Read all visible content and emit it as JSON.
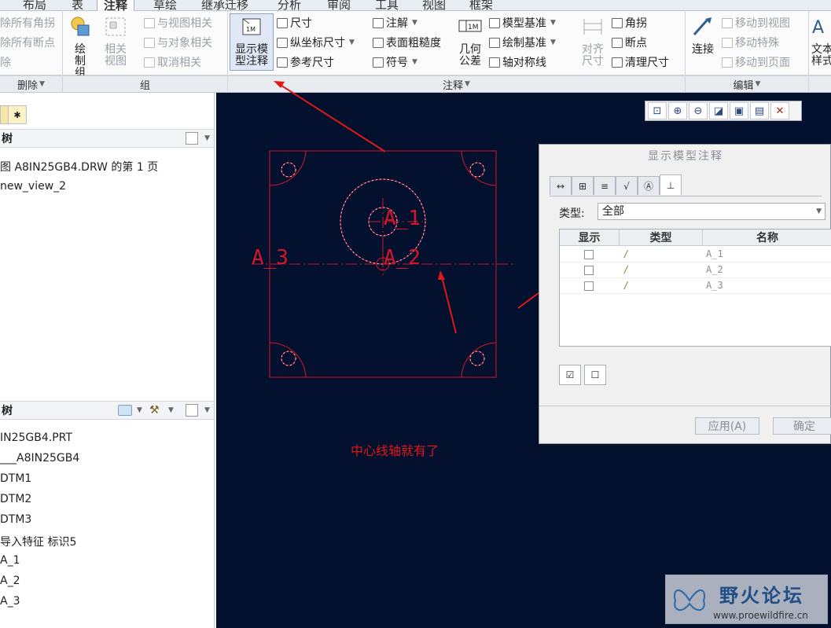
{
  "ribbon_tabs": [
    "布局",
    "表",
    "注释",
    "草绘",
    "继承迁移",
    "分析",
    "审阅",
    "工具",
    "视图",
    "框架"
  ],
  "active_tab": "注释",
  "group_delete": {
    "items": [
      "除所有角拐",
      "除所有断点",
      "除"
    ],
    "label": "删除"
  },
  "group_group": {
    "draw_group": "绘制组",
    "related_view": "相关视图",
    "items": [
      "与视图相关",
      "与对象相关",
      "取消相关"
    ],
    "label": "组"
  },
  "group_annotation": {
    "show_model_annotation": "显示模型注释",
    "col1": [
      "尺寸",
      "纵坐标尺寸",
      "参考尺寸"
    ],
    "col2": [
      "注解",
      "表面粗糙度",
      "符号"
    ],
    "geo_tolerance": "几何公差",
    "col3": [
      "模型基准",
      "绘制基准",
      "轴对称线"
    ],
    "align_dimension": "对齐尺寸",
    "col4": [
      "角拐",
      "断点",
      "清理尺寸"
    ],
    "label": "注释"
  },
  "group_edit": {
    "connect": "连接",
    "items": [
      "移动到视图",
      "移动特殊",
      "移动到页面"
    ],
    "label": "编辑"
  },
  "text_style": "文本样式",
  "layer_tree": {
    "title": "树",
    "items": [
      "图 A8IN25GB4.DRW 的第 1 页",
      "new_view_2"
    ]
  },
  "model_tree": {
    "title": "树",
    "items": [
      "IN25GB4.PRT",
      "___A8IN25GB4",
      "DTM1",
      "DTM2",
      "DTM3",
      "导入特征 标识5",
      "A_1",
      "A_2",
      "A_3"
    ]
  },
  "drawing": {
    "labels": [
      "A_1",
      "A_2",
      "A_3"
    ],
    "annotation_text": "中心线轴就有了",
    "colors": {
      "background": "#03112e",
      "geometry": "#d6152a",
      "centerline": "#e8e8f0",
      "arrow": "#e01818"
    }
  },
  "dialog": {
    "title": "显示模型注释",
    "type_label": "类型:",
    "type_value": "全部",
    "col_show": "显示",
    "col_type": "类型",
    "col_name": "名称",
    "rows": [
      "A_1",
      "A_2",
      "A_3"
    ],
    "apply": "应用(A)",
    "ok": "确定"
  },
  "watermark": {
    "title": "野火论坛",
    "url": "www.proewildfire.cn"
  }
}
